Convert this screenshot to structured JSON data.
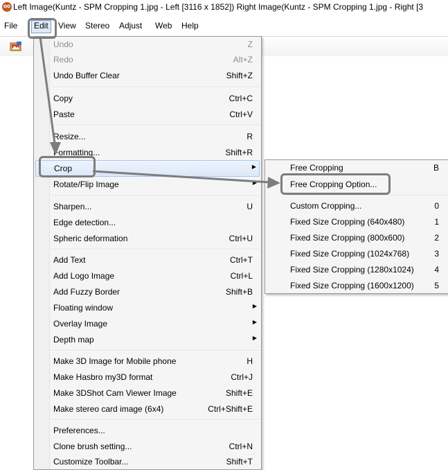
{
  "window": {
    "title": "Left Image(Kuntz - SPM Cropping 1.jpg - Left [3116 x 1852]) Right Image(Kuntz - SPM Cropping 1.jpg - Right [3"
  },
  "menubar": {
    "file": "File",
    "edit": "Edit",
    "view": "View",
    "stereo": "Stereo",
    "adjust": "Adjust",
    "web": "Web",
    "help": "Help"
  },
  "edit_menu": {
    "items": [
      {
        "label": "Undo",
        "shortcut": "Z",
        "disabled": true
      },
      {
        "label": "Redo",
        "shortcut": "Alt+Z",
        "disabled": true
      },
      {
        "label": "Undo Buffer Clear",
        "shortcut": "Shift+Z"
      },
      {
        "label": "Copy",
        "shortcut": "Ctrl+C"
      },
      {
        "label": "Paste",
        "shortcut": "Ctrl+V"
      },
      {
        "label": "Resize...",
        "shortcut": "R"
      },
      {
        "label": "Formatting...",
        "shortcut": "Shift+R"
      },
      {
        "label": "Crop",
        "shortcut": "",
        "submenu": true
      },
      {
        "label": "Rotate/Flip Image",
        "shortcut": "",
        "submenu": true
      },
      {
        "label": "Sharpen...",
        "shortcut": "U"
      },
      {
        "label": "Edge detection...",
        "shortcut": ""
      },
      {
        "label": "Spheric deformation",
        "shortcut": "Ctrl+U"
      },
      {
        "label": "Add Text",
        "shortcut": "Ctrl+T"
      },
      {
        "label": "Add Logo Image",
        "shortcut": "Ctrl+L"
      },
      {
        "label": "Add Fuzzy Border",
        "shortcut": "Shift+B"
      },
      {
        "label": "Floating window",
        "shortcut": "",
        "submenu": true
      },
      {
        "label": "Overlay Image",
        "shortcut": "",
        "submenu": true
      },
      {
        "label": "Depth map",
        "shortcut": "",
        "submenu": true
      },
      {
        "label": "Make 3D Image for Mobile phone",
        "shortcut": "H"
      },
      {
        "label": "Make Hasbro my3D format",
        "shortcut": "Ctrl+J"
      },
      {
        "label": "Make 3DShot Cam Viewer Image",
        "shortcut": "Shift+E"
      },
      {
        "label": "Make stereo card image (6x4)",
        "shortcut": "Ctrl+Shift+E"
      },
      {
        "label": "Preferences...",
        "shortcut": ""
      },
      {
        "label": "Clone brush setting...",
        "shortcut": "Ctrl+N"
      },
      {
        "label": "Customize Toolbar...",
        "shortcut": "Shift+T"
      }
    ]
  },
  "crop_submenu": {
    "items": [
      {
        "label": "Free Cropping",
        "shortcut": "B"
      },
      {
        "label": "Free Cropping Option...",
        "shortcut": ""
      },
      {
        "label": "Custom Cropping...",
        "shortcut": "0"
      },
      {
        "label": "Fixed Size Cropping (640x480)",
        "shortcut": "1"
      },
      {
        "label": "Fixed Size Cropping (800x600)",
        "shortcut": "2"
      },
      {
        "label": "Fixed Size Cropping (1024x768)",
        "shortcut": "3"
      },
      {
        "label": "Fixed Size Cropping (1280x1024)",
        "shortcut": "4"
      },
      {
        "label": "Fixed Size Cropping (1600x1200)",
        "shortcut": "5"
      }
    ]
  },
  "icons": {
    "app": "stereo-photo-maker-icon",
    "toolbar": "open-image-icon",
    "submenu_arrow": "right-triangle"
  },
  "colors": {
    "highlight_border": "#a8c6ef",
    "callout": "#7d7d7d",
    "disabled_text": "#8d8d8d"
  }
}
